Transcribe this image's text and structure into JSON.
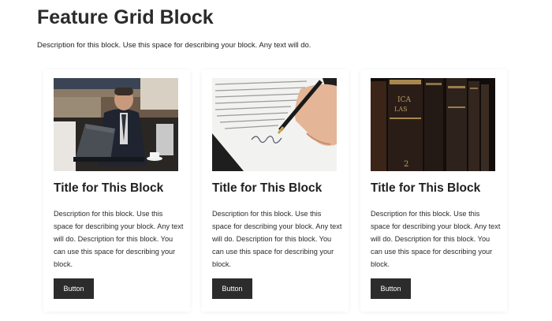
{
  "page": {
    "title": "Feature Grid Block",
    "description": "Description for this block. Use this space for describing your block. Any text will do."
  },
  "cards": [
    {
      "title": "Title for This Block",
      "description": "Description for this block. Use this space for describing your block. Any text will do. Description for this block. You can use this space for describing your block.",
      "button_label": "Button"
    },
    {
      "title": "Title for This Block",
      "description": "Description for this block. Use this space for describing your block. Any text will do. Description for this block. You can use this space for describing your block.",
      "button_label": "Button"
    },
    {
      "title": "Title for This Block",
      "description": "Description for this block. Use this space for describing your block. Any text will do. Description for this block. You can use this space for describing your block.",
      "button_label": "Button"
    }
  ],
  "colors": {
    "button_bg": "#2c2c2c",
    "title_text": "#1f1f1f"
  }
}
